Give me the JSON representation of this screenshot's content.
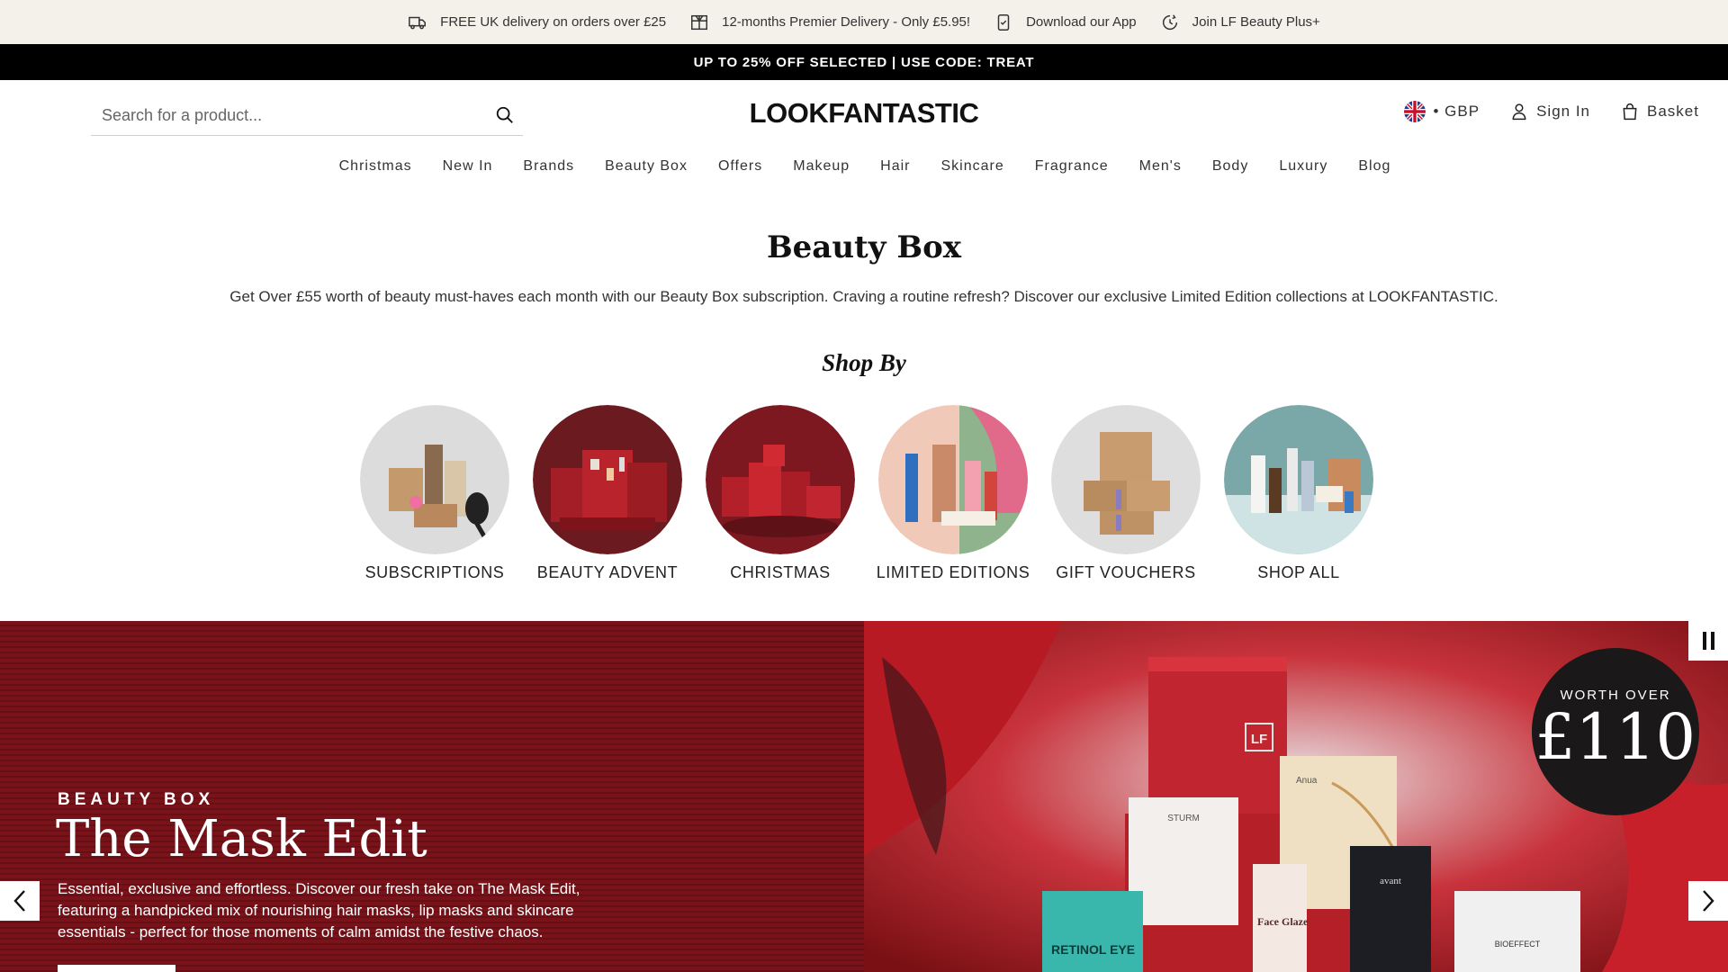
{
  "utility": [
    {
      "icon": "truck-icon",
      "text": "FREE UK delivery on orders over £25"
    },
    {
      "icon": "gift-calendar-icon",
      "text": "12-months Premier Delivery - Only £5.95!"
    },
    {
      "icon": "phone-icon",
      "text": "Download our App"
    },
    {
      "icon": "refresh-icon",
      "text": "Join LF Beauty Plus+"
    }
  ],
  "promo": "UP TO 25% OFF SELECTED | USE CODE: TREAT",
  "header": {
    "search_placeholder": "Search for a product...",
    "logo": "LOOKFANTASTIC",
    "currency": "• GBP",
    "sign_in": "Sign In",
    "basket": "Basket"
  },
  "nav": [
    "Christmas",
    "New In",
    "Brands",
    "Beauty Box",
    "Offers",
    "Makeup",
    "Hair",
    "Skincare",
    "Fragrance",
    "Men's",
    "Body",
    "Luxury",
    "Blog"
  ],
  "hero": {
    "title": "Beauty Box",
    "description": "Get Over £55 worth of beauty must-haves each month with our Beauty Box subscription. Craving a routine refresh? Discover our exclusive Limited Edition collections at LOOKFANTASTIC.",
    "shop_by": "Shop By"
  },
  "categories": [
    {
      "label": "SUBSCRIPTIONS"
    },
    {
      "label": "BEAUTY ADVENT"
    },
    {
      "label": "CHRISTMAS"
    },
    {
      "label": "LIMITED EDITIONS"
    },
    {
      "label": "GIFT VOUCHERS"
    },
    {
      "label": "SHOP ALL"
    }
  ],
  "banner": {
    "kicker": "BEAUTY BOX",
    "title": "The Mask Edit",
    "text": "Essential, exclusive and effortless. Discover our fresh take on The Mask Edit, featuring a handpicked mix of nourishing hair masks, lip masks and skincare essentials - perfect for those moments of calm amidst the festive chaos.",
    "worth_label": "WORTH OVER",
    "worth_amount": "£110",
    "box_logo": "LF",
    "products": [
      "STURM",
      "Anua",
      "Face Glaze",
      "avant",
      "RETINOL EYE",
      "BIOEFFECT"
    ]
  },
  "colors": {
    "utility_bg": "#f4f1ea",
    "promo_bg": "#000000",
    "banner_red": "#7a1219",
    "badge_bg": "#1a1818"
  }
}
